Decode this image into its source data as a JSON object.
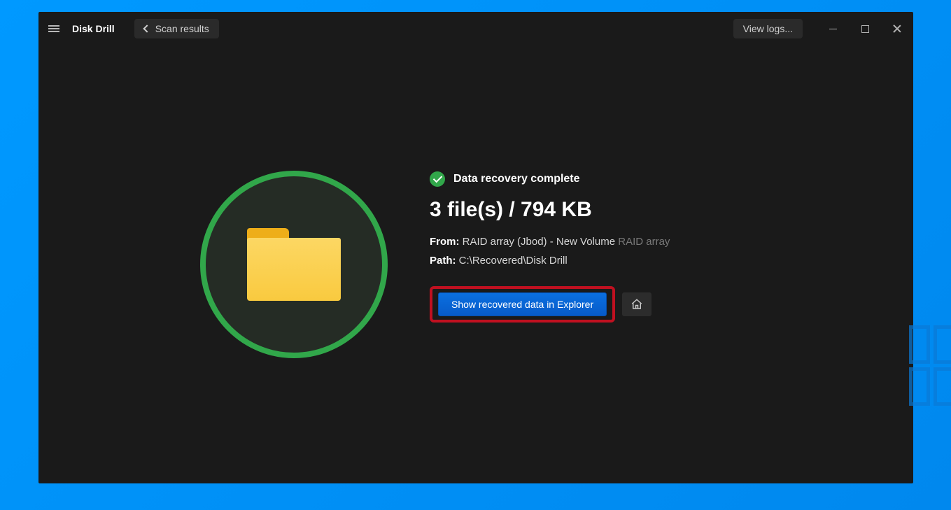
{
  "titlebar": {
    "app_name": "Disk Drill",
    "back_label": "Scan results",
    "view_logs_label": "View logs..."
  },
  "status": {
    "title": "Data recovery complete",
    "summary": "3 file(s) / 794 KB"
  },
  "details": {
    "from_label": "From:",
    "from_value": "RAID array (Jbod) - New Volume",
    "from_extra": "RAID array",
    "path_label": "Path:",
    "path_value": "C:\\Recovered\\Disk Drill"
  },
  "actions": {
    "show_in_explorer": "Show recovered data in Explorer"
  }
}
